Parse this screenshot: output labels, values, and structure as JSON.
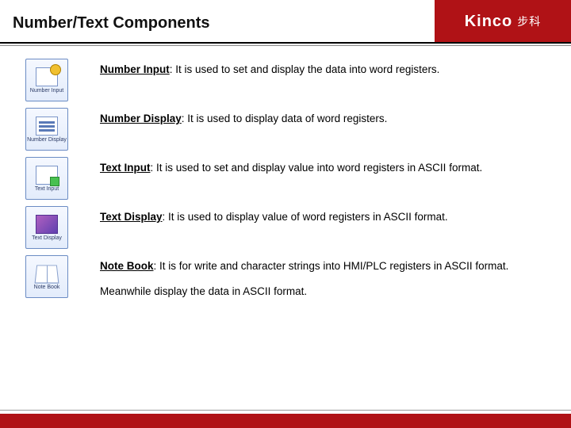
{
  "header": {
    "title": "Number/Text Components",
    "brand": "Kinco",
    "brand_cjk": "步科"
  },
  "items": [
    {
      "icon_name": "number-input-icon",
      "icon_label": "Number Input",
      "term": "Number Input",
      "desc": ": It is used to set and display the data into word registers."
    },
    {
      "icon_name": "number-display-icon",
      "icon_label": "Number Display",
      "term": "Number Display",
      "desc": ": It is used to display data of word registers."
    },
    {
      "icon_name": "text-input-icon",
      "icon_label": "Text Input",
      "term": "Text Input",
      "desc": ": It is used to set and display value into word registers in ASCII format."
    },
    {
      "icon_name": "text-display-icon",
      "icon_label": "Text Display",
      "term": "Text Display",
      "desc": ": It is used to display value of word registers in ASCII format."
    },
    {
      "icon_name": "note-book-icon",
      "icon_label": "Note Book",
      "term": "Note Book",
      "desc": ": It is for write and character strings into HMI/PLC registers in ASCII format.  Meanwhile display the data in ASCII format."
    }
  ]
}
